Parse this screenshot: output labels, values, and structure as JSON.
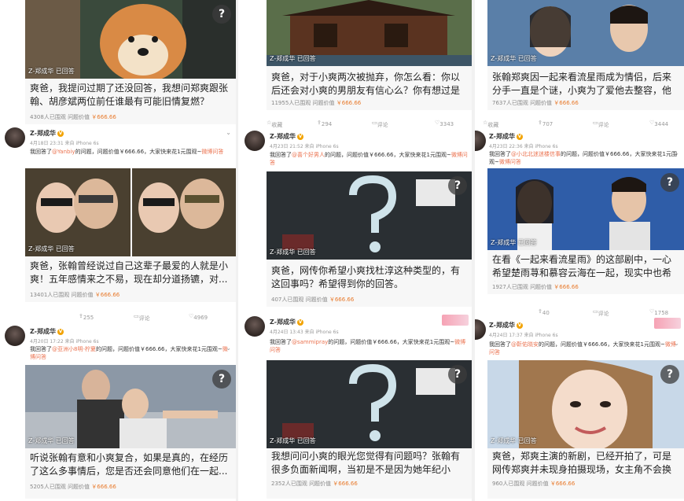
{
  "user_name": "Z-郑成华",
  "answered_label": "Z-郑成华 已回答",
  "source": "iPhone 6s",
  "ask_prefix": "我回答了",
  "ask_suffix": "的问题，问题价值￥666.66，大家快来花1元围观~",
  "answer_link": "微博问答",
  "price_prefix": "问题价值",
  "price": "￥666.66",
  "icons": {
    "question": "?",
    "verified": "V",
    "chevron": "⌄"
  },
  "columns": {
    "c1": {
      "top_card": {
        "question": "爽爸，我提问过期了还没回答，我想问郑爽跟张翰、胡彦斌两位前任谁最有可能旧情复燃？",
        "views": "4308人已围观"
      },
      "post1": {
        "time": "4月18日 23:31 来自 iPhone 6s",
        "mention": "@Yanbiy",
        "question": "爽爸，张翰曾经说过自己这辈子最爱的人就是小爽！五年感情来之不易，现在却分道扬镳，对...",
        "views": "13401人已围观",
        "shares": "255",
        "comments": "评论",
        "likes": "4969"
      },
      "post2": {
        "time": "4月20日 17:22 来自 iPhone 6s",
        "mention": "@亚洲小8明-柠夏",
        "question": "听说张翰有意和小爽复合，如果是真的，在经历了这么多事情后，您是否还会同意他们在一起...",
        "views": "5205人已围观"
      }
    },
    "c2": {
      "top_card": {
        "question": "爽爸，对于小爽两次被抛弃，你怎么看：你以后还会对小爽的男朋友有信心么？你有想过是什...",
        "views": "11955人已围观"
      },
      "bar_top": {
        "collect": "收藏",
        "shares": "294",
        "comments": "评论",
        "likes": "3343"
      },
      "post1": {
        "time": "4月23日 21:52 来自 iPhone 6s",
        "mention": "@喜个好男人",
        "question": "爽爸，网传你希望小爽找杜淳这种类型的，有这回事吗？希望得到你的回答。",
        "views": "407人已围观"
      },
      "post2": {
        "time": "4月24日 13:43 来自 iPhone 6s",
        "mention": "@sammipray",
        "question": "我想问问小爽的眼光您觉得有问题吗？张翰有很多负面新闻啊，当初是不是因为她年纪小啊？...",
        "views": "2352人已围观"
      }
    },
    "c3": {
      "top_card": {
        "question": "张翰郑爽因一起来看流星雨成为情侣，后来分手一直是个谜，小爽为了爱他去整容，他们之间...",
        "views": "7637人已围观"
      },
      "bar_top": {
        "collect": "收藏",
        "shares": "707",
        "comments": "评论",
        "likes": "3444"
      },
      "post1": {
        "time": "4月23日 22:36 来自 iPhone 6s",
        "mention": "@小北北迷迷楼信事",
        "question": "在看《一起来看流星雨》的这部剧中，一心希望楚雨荨和慕容云海在一起，现实中也希望小爽...",
        "views": "1927人已围观",
        "shares": "40",
        "comments": "评论",
        "likes": "1758"
      },
      "post2": {
        "time": "4月24日 17:37 来自 iPhone 6s",
        "mention": "@靳佑晓安",
        "question": "爽爸，郑爽主演的新剧，已经开拍了，可是网传郑爽并未现身拍摄现场，女主角不会换人了吧...",
        "views": "960人已围观"
      }
    }
  },
  "colors": {
    "orange": "#eb7350",
    "price": "#e87a2c",
    "vip": "#f2a300"
  }
}
